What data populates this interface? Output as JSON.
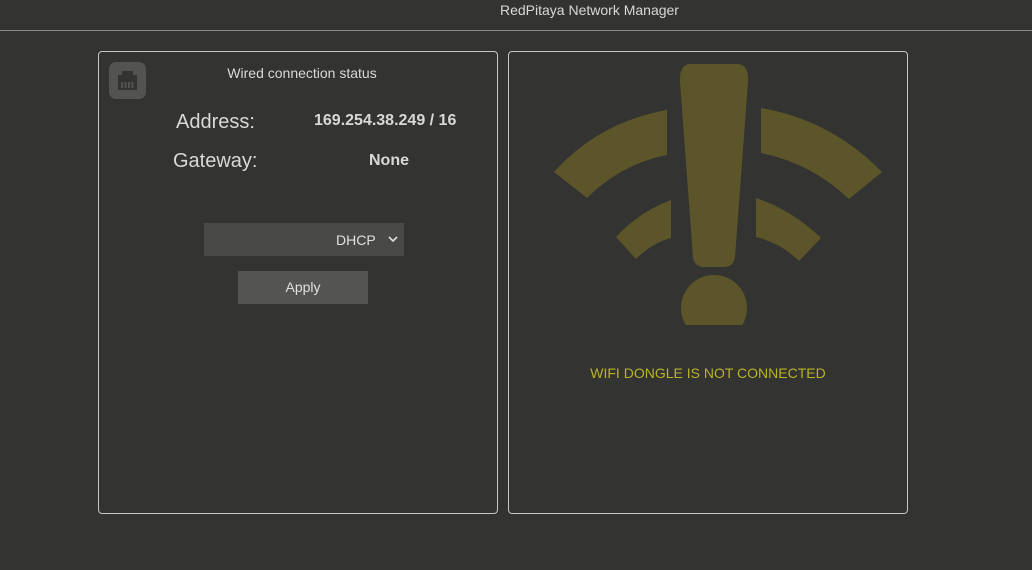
{
  "header": {
    "title": "RedPitaya Network Manager"
  },
  "wired": {
    "title": "Wired connection status",
    "address_label": "Address:",
    "address_value": "169.254.38.249 / 16",
    "gateway_label": "Gateway:",
    "gateway_value": "None",
    "mode_selected": "DHCP",
    "apply_label": "Apply",
    "icon": "ethernet-port-icon"
  },
  "wifi": {
    "message": "WIFI DONGLE IS NOT CONNECTED",
    "icon": "wifi-warning-icon",
    "icon_color": "#5b5529",
    "message_color": "#b9b424"
  },
  "colors": {
    "background": "#333331",
    "panel_border": "#c6c6c4",
    "text": "#d8d8d8"
  }
}
